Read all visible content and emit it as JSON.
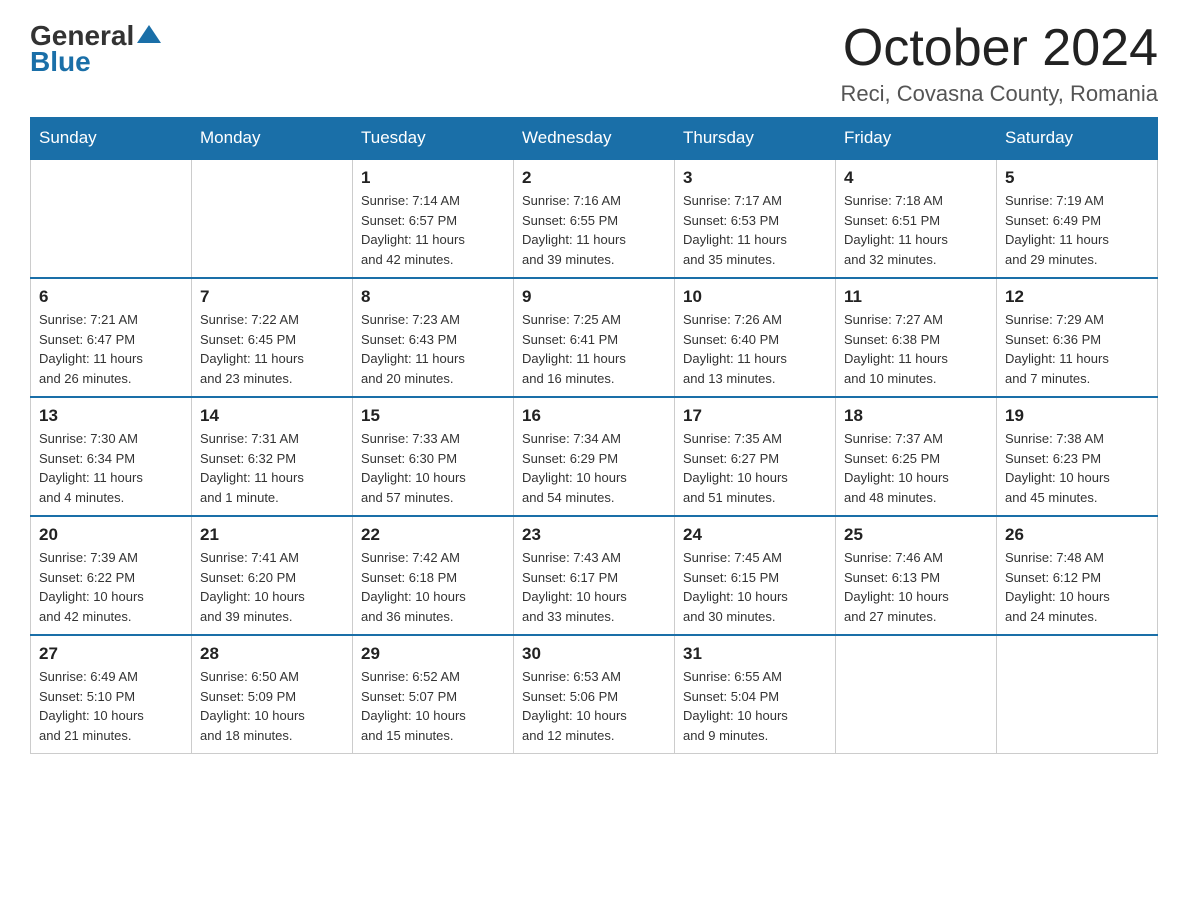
{
  "logo": {
    "general": "General",
    "blue": "Blue"
  },
  "header": {
    "month": "October 2024",
    "location": "Reci, Covasna County, Romania"
  },
  "weekdays": [
    "Sunday",
    "Monday",
    "Tuesday",
    "Wednesday",
    "Thursday",
    "Friday",
    "Saturday"
  ],
  "weeks": [
    [
      {
        "day": "",
        "info": ""
      },
      {
        "day": "",
        "info": ""
      },
      {
        "day": "1",
        "info": "Sunrise: 7:14 AM\nSunset: 6:57 PM\nDaylight: 11 hours\nand 42 minutes."
      },
      {
        "day": "2",
        "info": "Sunrise: 7:16 AM\nSunset: 6:55 PM\nDaylight: 11 hours\nand 39 minutes."
      },
      {
        "day": "3",
        "info": "Sunrise: 7:17 AM\nSunset: 6:53 PM\nDaylight: 11 hours\nand 35 minutes."
      },
      {
        "day": "4",
        "info": "Sunrise: 7:18 AM\nSunset: 6:51 PM\nDaylight: 11 hours\nand 32 minutes."
      },
      {
        "day": "5",
        "info": "Sunrise: 7:19 AM\nSunset: 6:49 PM\nDaylight: 11 hours\nand 29 minutes."
      }
    ],
    [
      {
        "day": "6",
        "info": "Sunrise: 7:21 AM\nSunset: 6:47 PM\nDaylight: 11 hours\nand 26 minutes."
      },
      {
        "day": "7",
        "info": "Sunrise: 7:22 AM\nSunset: 6:45 PM\nDaylight: 11 hours\nand 23 minutes."
      },
      {
        "day": "8",
        "info": "Sunrise: 7:23 AM\nSunset: 6:43 PM\nDaylight: 11 hours\nand 20 minutes."
      },
      {
        "day": "9",
        "info": "Sunrise: 7:25 AM\nSunset: 6:41 PM\nDaylight: 11 hours\nand 16 minutes."
      },
      {
        "day": "10",
        "info": "Sunrise: 7:26 AM\nSunset: 6:40 PM\nDaylight: 11 hours\nand 13 minutes."
      },
      {
        "day": "11",
        "info": "Sunrise: 7:27 AM\nSunset: 6:38 PM\nDaylight: 11 hours\nand 10 minutes."
      },
      {
        "day": "12",
        "info": "Sunrise: 7:29 AM\nSunset: 6:36 PM\nDaylight: 11 hours\nand 7 minutes."
      }
    ],
    [
      {
        "day": "13",
        "info": "Sunrise: 7:30 AM\nSunset: 6:34 PM\nDaylight: 11 hours\nand 4 minutes."
      },
      {
        "day": "14",
        "info": "Sunrise: 7:31 AM\nSunset: 6:32 PM\nDaylight: 11 hours\nand 1 minute."
      },
      {
        "day": "15",
        "info": "Sunrise: 7:33 AM\nSunset: 6:30 PM\nDaylight: 10 hours\nand 57 minutes."
      },
      {
        "day": "16",
        "info": "Sunrise: 7:34 AM\nSunset: 6:29 PM\nDaylight: 10 hours\nand 54 minutes."
      },
      {
        "day": "17",
        "info": "Sunrise: 7:35 AM\nSunset: 6:27 PM\nDaylight: 10 hours\nand 51 minutes."
      },
      {
        "day": "18",
        "info": "Sunrise: 7:37 AM\nSunset: 6:25 PM\nDaylight: 10 hours\nand 48 minutes."
      },
      {
        "day": "19",
        "info": "Sunrise: 7:38 AM\nSunset: 6:23 PM\nDaylight: 10 hours\nand 45 minutes."
      }
    ],
    [
      {
        "day": "20",
        "info": "Sunrise: 7:39 AM\nSunset: 6:22 PM\nDaylight: 10 hours\nand 42 minutes."
      },
      {
        "day": "21",
        "info": "Sunrise: 7:41 AM\nSunset: 6:20 PM\nDaylight: 10 hours\nand 39 minutes."
      },
      {
        "day": "22",
        "info": "Sunrise: 7:42 AM\nSunset: 6:18 PM\nDaylight: 10 hours\nand 36 minutes."
      },
      {
        "day": "23",
        "info": "Sunrise: 7:43 AM\nSunset: 6:17 PM\nDaylight: 10 hours\nand 33 minutes."
      },
      {
        "day": "24",
        "info": "Sunrise: 7:45 AM\nSunset: 6:15 PM\nDaylight: 10 hours\nand 30 minutes."
      },
      {
        "day": "25",
        "info": "Sunrise: 7:46 AM\nSunset: 6:13 PM\nDaylight: 10 hours\nand 27 minutes."
      },
      {
        "day": "26",
        "info": "Sunrise: 7:48 AM\nSunset: 6:12 PM\nDaylight: 10 hours\nand 24 minutes."
      }
    ],
    [
      {
        "day": "27",
        "info": "Sunrise: 6:49 AM\nSunset: 5:10 PM\nDaylight: 10 hours\nand 21 minutes."
      },
      {
        "day": "28",
        "info": "Sunrise: 6:50 AM\nSunset: 5:09 PM\nDaylight: 10 hours\nand 18 minutes."
      },
      {
        "day": "29",
        "info": "Sunrise: 6:52 AM\nSunset: 5:07 PM\nDaylight: 10 hours\nand 15 minutes."
      },
      {
        "day": "30",
        "info": "Sunrise: 6:53 AM\nSunset: 5:06 PM\nDaylight: 10 hours\nand 12 minutes."
      },
      {
        "day": "31",
        "info": "Sunrise: 6:55 AM\nSunset: 5:04 PM\nDaylight: 10 hours\nand 9 minutes."
      },
      {
        "day": "",
        "info": ""
      },
      {
        "day": "",
        "info": ""
      }
    ]
  ]
}
